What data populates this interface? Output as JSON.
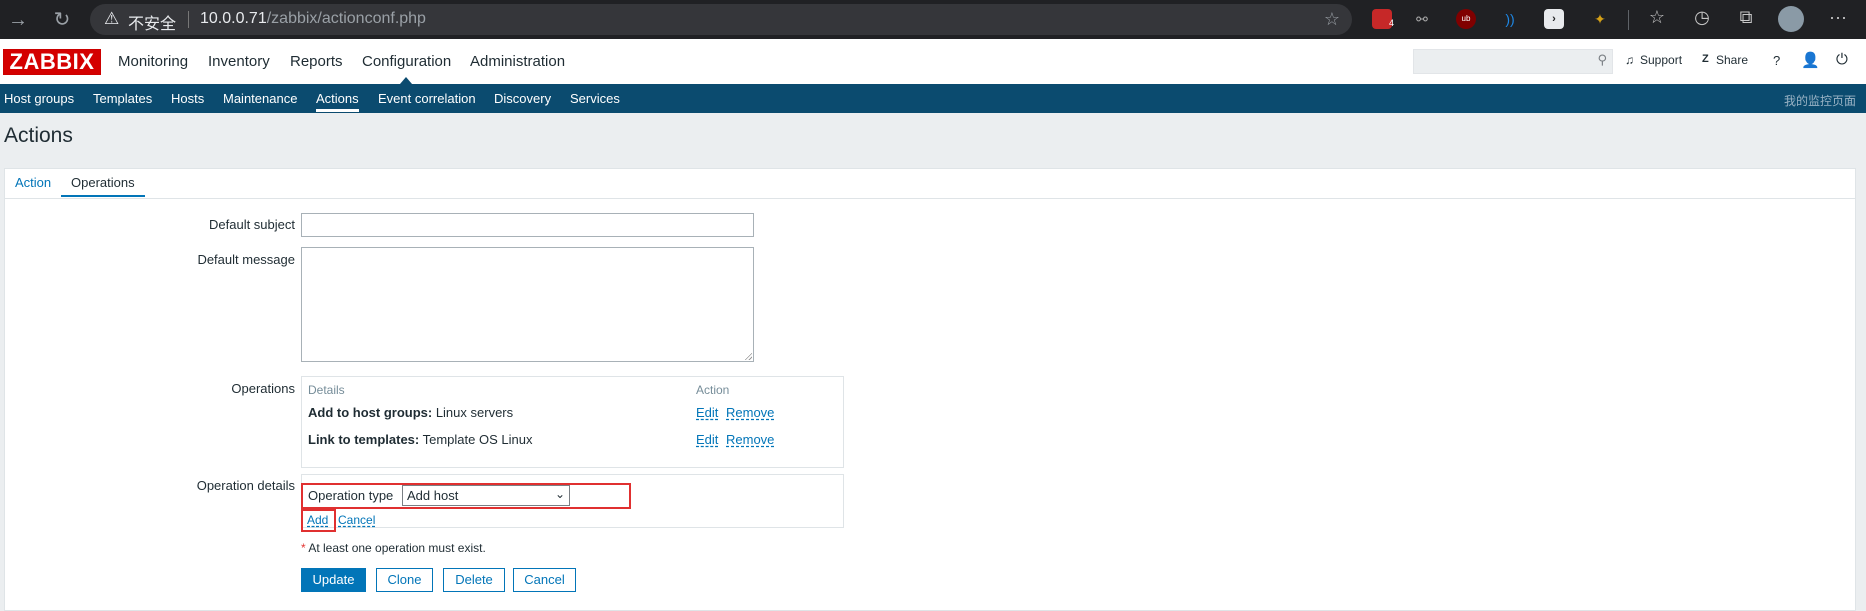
{
  "browser": {
    "insecure_label": "不安全",
    "url_host": "10.0.0.71",
    "url_path": "/zabbix/actionconf.php",
    "ext_badge": "4",
    "ext_ub": "ub"
  },
  "header": {
    "logo": "ZABBIX",
    "menu": [
      "Monitoring",
      "Inventory",
      "Reports",
      "Configuration",
      "Administration"
    ],
    "support": "Support",
    "share": "Share",
    "help": "?"
  },
  "subnav": {
    "items": [
      "Host groups",
      "Templates",
      "Hosts",
      "Maintenance",
      "Actions",
      "Event correlation",
      "Discovery",
      "Services"
    ],
    "right_link": "我的监控页面"
  },
  "page": {
    "title": "Actions",
    "tabs": [
      "Action",
      "Operations"
    ]
  },
  "form": {
    "default_subject_label": "Default subject",
    "default_subject_value": "",
    "default_message_label": "Default message",
    "default_message_value": "",
    "operations_label": "Operations",
    "operations_table": {
      "headers": [
        "Details",
        "Action"
      ],
      "rows": [
        {
          "bold": "Add to host groups:",
          "text": " Linux servers",
          "edit": "Edit",
          "remove": "Remove"
        },
        {
          "bold": "Link to templates:",
          "text": " Template OS Linux",
          "edit": "Edit",
          "remove": "Remove"
        }
      ]
    },
    "operation_details_label": "Operation details",
    "operation_type_label": "Operation type",
    "operation_type_value": "Add host",
    "add_link": "Add",
    "cancel_link": "Cancel",
    "note": "At least one operation must exist.",
    "note_asterisk": "*",
    "buttons": {
      "update": "Update",
      "clone": "Clone",
      "delete": "Delete",
      "cancel": "Cancel"
    }
  },
  "colors": {
    "brand_red": "#d40000",
    "subnav_bg": "#0b4b6f",
    "link": "#0275b8",
    "highlight_box": "#e03030"
  }
}
